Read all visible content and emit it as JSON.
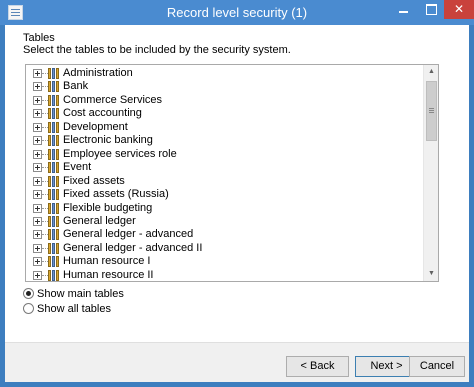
{
  "window": {
    "title": "Record level security (1)"
  },
  "content": {
    "heading": "Tables",
    "description": "Select the tables to be included by the security system."
  },
  "tables": [
    "Administration",
    "Bank",
    "Commerce Services",
    "Cost accounting",
    "Development",
    "Electronic banking",
    "Employee services role",
    "Event",
    "Fixed assets",
    "Fixed assets (Russia)",
    "Flexible budgeting",
    "General ledger",
    "General ledger - advanced",
    "General ledger - advanced II",
    "Human resource I",
    "Human resource II"
  ],
  "options": {
    "show_main": "Show main tables",
    "show_all": "Show all tables",
    "selected": "Show main tables"
  },
  "buttons": {
    "back": "< Back",
    "next": "Next >",
    "cancel": "Cancel"
  },
  "colors": {
    "titlebar": "#4a8bd0",
    "close_button": "#c9423c"
  }
}
